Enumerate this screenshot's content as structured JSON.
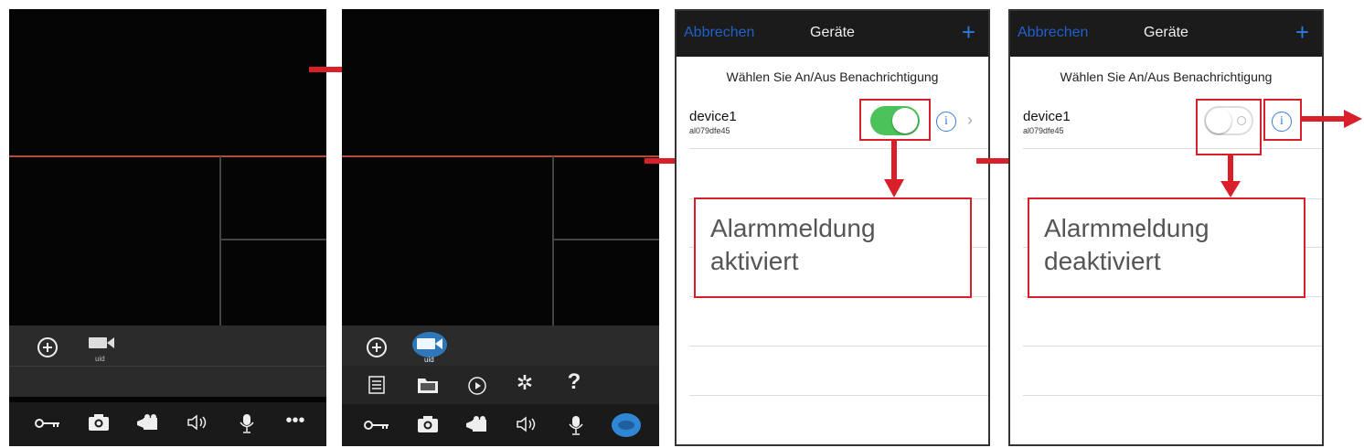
{
  "screen1": {
    "toolbar_icons": [
      "add-circle-icon",
      "video-camera-icon"
    ],
    "uid_label": "uid",
    "bottom_icons": [
      "key-icon",
      "camera-icon",
      "video-record-icon",
      "speaker-icon",
      "microphone-icon",
      "more-icon"
    ]
  },
  "screen2": {
    "toolbar_icons": [
      "add-circle-icon",
      "video-camera-icon"
    ],
    "uid_label": "uid",
    "middle_icons": [
      "list-icon",
      "folder-icon",
      "play-icon",
      "gear-icon",
      "help-icon"
    ],
    "middle_help_glyph": "?",
    "bottom_icons": [
      "key-icon",
      "camera-icon",
      "video-record-icon",
      "speaker-icon",
      "microphone-icon",
      "settings-badge-icon"
    ]
  },
  "screen3": {
    "nav": {
      "cancel": "Abbrechen",
      "title": "Geräte",
      "add": "+"
    },
    "prompt": "Wählen Sie An/Aus Benachrichtigung",
    "device": {
      "name": "device1",
      "id": "al079dfe45",
      "notification_on": true
    },
    "callout": {
      "line1": "Alarmmeldung",
      "line2": "aktiviert"
    }
  },
  "screen4": {
    "nav": {
      "cancel": "Abbrechen",
      "title": "Geräte",
      "add": "+"
    },
    "prompt": "Wählen Sie An/Aus Benachrichtigung",
    "device": {
      "name": "device1",
      "id": "al079dfe45",
      "notification_on": false
    },
    "callout": {
      "line1": "Alarmmeldung",
      "line2": "deaktiviert"
    }
  },
  "colors": {
    "accent_red": "#d9202a",
    "toggle_on": "#4cc35a",
    "link_blue": "#2a7ae2"
  }
}
